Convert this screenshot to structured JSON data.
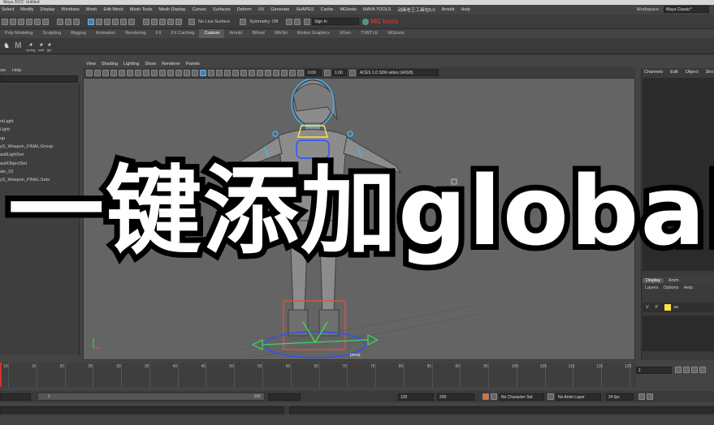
{
  "window": {
    "title": "Maya 2022: Untitled"
  },
  "menubar": {
    "items": [
      "Select",
      "Modify",
      "Display",
      "Windows",
      "Mesh",
      "Edit Mesh",
      "Mesh Tools",
      "Mesh Display",
      "Curves",
      "Surfaces",
      "Deform",
      "UV",
      "Generate",
      "SHAPES",
      "Cache",
      "MGtools",
      "MAYA TOOLS",
      "动画老王工具包5.0",
      "Arnold",
      "Help"
    ],
    "workspace_label": "Workspace :",
    "workspace_value": "Maya Classic*"
  },
  "statusline": {
    "live_surface": "No Live Surface",
    "symmetry": "Symmetry: Off",
    "sign_in": "Sign In",
    "brand_badge": "MG tools"
  },
  "shelf": {
    "tabs": [
      "Poly Modeling",
      "Sculpting",
      "Rigging",
      "Animation",
      "Rendering",
      "FX",
      "FX Caching",
      "Custom",
      "Arnold",
      "Bifrost",
      "MASH",
      "Motion Graphics",
      "XGen",
      "TURTLE",
      "MGtools"
    ],
    "active_tab": "Custom",
    "buttons": [
      "spring",
      "add",
      "glo"
    ]
  },
  "outliner": {
    "menu": [
      "ow",
      "Help"
    ],
    "items": [
      "",
      "",
      "",
      "",
      "ntLight",
      "Light",
      "up",
      "yS_Weapon_FINAL:Group",
      "aultLightSet",
      "aultObjectSet",
      "ain_02",
      "yS_Weapon_FINAL:Sets"
    ]
  },
  "viewport": {
    "menu": [
      "View",
      "Shading",
      "Lighting",
      "Show",
      "Renderer",
      "Panels"
    ],
    "exposure": "0.00",
    "gamma": "1.00",
    "color_space": "ACES 1.0 SDR-video (sRGB)",
    "camera_label": "persp"
  },
  "channelbox": {
    "menu": [
      "Channels",
      "Edit",
      "Object",
      "Sho"
    ]
  },
  "layers": {
    "tabs": [
      "Display",
      "Anim"
    ],
    "menu": [
      "Layers",
      "Options",
      "Help"
    ],
    "row": {
      "v": "V",
      "p": "P",
      "name": "ao"
    }
  },
  "timeslider": {
    "ticks": [
      "10",
      "15",
      "20",
      "25",
      "30",
      "35",
      "40",
      "45",
      "50",
      "55",
      "60",
      "65",
      "70",
      "75",
      "80",
      "85",
      "90",
      "95",
      "100",
      "105",
      "110",
      "115",
      "120"
    ],
    "current_frame": "1"
  },
  "rangebar": {
    "start": "1",
    "end": "100",
    "anim_end": "120",
    "anim_total": "200",
    "character_set": "No Character Set",
    "anim_layer": "No Anim Layer",
    "fps": "24 fps"
  },
  "overlay": {
    "caption": "一键添加global"
  },
  "colors": {
    "accent_blue": "#4a7fb5",
    "brand_red": "#d33030",
    "highlight_yellow": "#ffe24a",
    "rig_cyan": "#39b7ff"
  }
}
